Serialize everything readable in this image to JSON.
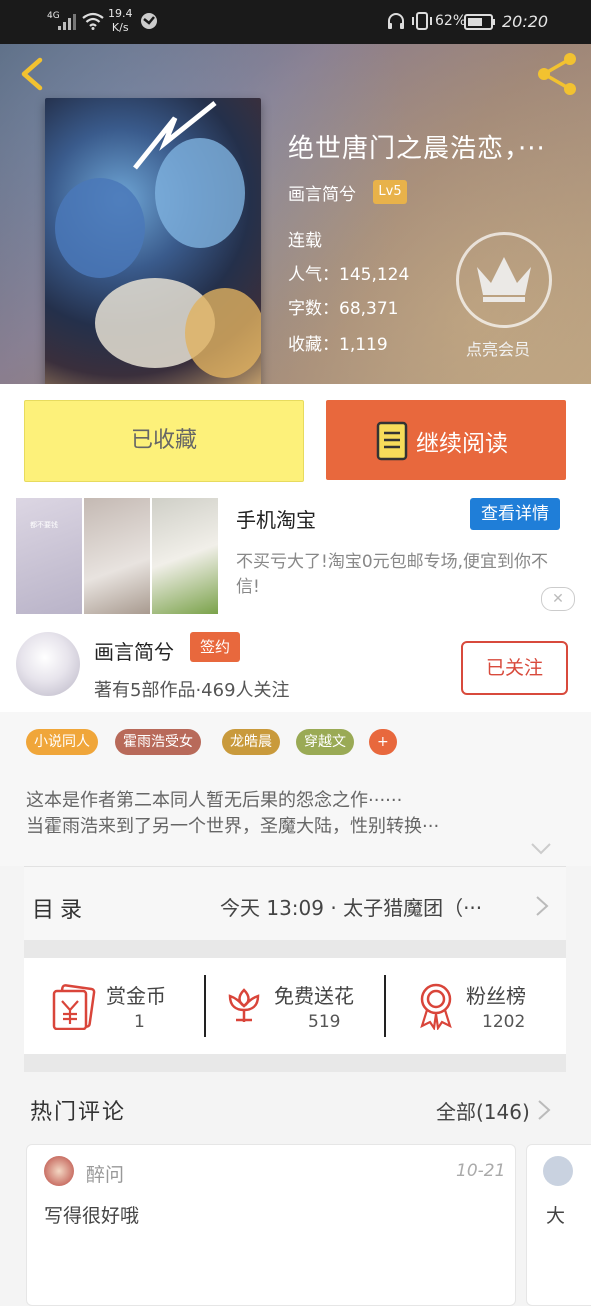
{
  "status_bar": {
    "network": "4G",
    "speed": "19.4\nK/s",
    "battery": "62%",
    "time": "20:20"
  },
  "header": {
    "title": "绝世唐门之晨浩恋，···",
    "author": "画言简兮",
    "level": "Lv5",
    "status": "连载",
    "popularity": "人气：145,124",
    "word_count": "字数：68,371",
    "favorites": "收藏：1,119",
    "vip_label": "点亮会员"
  },
  "actions": {
    "collected_label": "已收藏",
    "read_label": "继续阅读"
  },
  "ad": {
    "title": "手机淘宝",
    "detail_button": "查看详情",
    "description": "不买亏大了!淘宝0元包邮专场,便宜到你不信!",
    "close": "✕",
    "image_caption": "都不要钱"
  },
  "author": {
    "name": "画言简兮",
    "badge": "签约",
    "stats": "著有5部作品·469人关注",
    "follow_label": "已关注"
  },
  "tags": [
    {
      "label": "小说同人",
      "color": "#f0a63a"
    },
    {
      "label": "霍雨浩受女",
      "color": "#b86a5a"
    },
    {
      "label": "龙皓晨",
      "color": "#c99a3c"
    },
    {
      "label": "穿越文",
      "color": "#9aaa55"
    },
    {
      "label": "+",
      "color": "#e8683d"
    }
  ],
  "description": {
    "line1": "这本是作者第二本同人暂无后果的怨念之作······",
    "line2": "当霍雨浩来到了另一个世界，圣魔大陆，性别转换···"
  },
  "toc": {
    "label": "目录",
    "latest": "今天 13:09 · 太子猎魔团（···"
  },
  "stats": [
    {
      "label": "赏金币",
      "value": "1",
      "icon": "reward-coin-icon"
    },
    {
      "label": "免费送花",
      "value": "519",
      "icon": "flower-icon"
    },
    {
      "label": "粉丝榜",
      "value": "1202",
      "icon": "medal-icon"
    }
  ],
  "comments": {
    "header": "热门评论",
    "all_label": "全部(146)",
    "items": [
      {
        "name": "醉问",
        "date": "10-21",
        "text": "写得很好哦"
      },
      {
        "text": "大"
      }
    ]
  },
  "colors": {
    "accent": "#e8683d",
    "collected": "#fdf17a",
    "ad_button": "#1f7ed8",
    "follow": "#d84a3c"
  }
}
